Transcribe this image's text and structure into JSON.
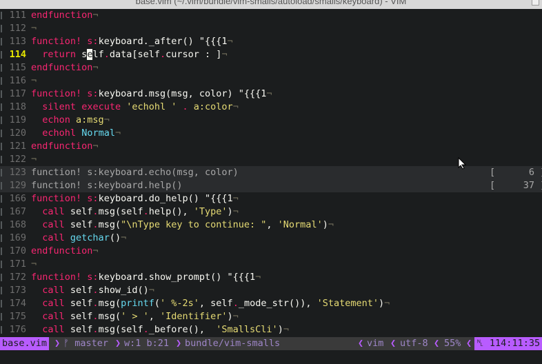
{
  "window": {
    "title": "base.vim (~/.vim/bundle/vim-smalls/autoload/smalls/keyboard) - VIM"
  },
  "lines": [
    {
      "num": "111",
      "tokens": [
        {
          "t": "endfunction",
          "c": "k"
        },
        {
          "t": "¬",
          "c": "m"
        }
      ]
    },
    {
      "num": "112",
      "tokens": [
        {
          "t": "¬",
          "c": "m"
        }
      ]
    },
    {
      "num": "113",
      "tokens": [
        {
          "t": "function!",
          "c": "k"
        },
        {
          "t": " ",
          "c": ""
        },
        {
          "t": "s:",
          "c": "k"
        },
        {
          "t": "keyboard._after() \"{{{1",
          "c": ""
        },
        {
          "t": "¬",
          "c": "m"
        }
      ]
    },
    {
      "num": "114",
      "current": true,
      "tokens": [
        {
          "t": "  ",
          "c": ""
        },
        {
          "t": "return",
          "c": "k"
        },
        {
          "t": " s",
          "c": ""
        },
        {
          "t": "e",
          "c": "cursor"
        },
        {
          "t": "lf",
          "c": ""
        },
        {
          "t": ".",
          "c": "k"
        },
        {
          "t": "data[self",
          "c": ""
        },
        {
          "t": ".",
          "c": "k"
        },
        {
          "t": "cursor : ]",
          "c": ""
        },
        {
          "t": "¬",
          "c": "m"
        }
      ]
    },
    {
      "num": "115",
      "tokens": [
        {
          "t": "endfunction",
          "c": "k"
        },
        {
          "t": "¬",
          "c": "m"
        }
      ]
    },
    {
      "num": "116",
      "tokens": [
        {
          "t": "¬",
          "c": "m"
        }
      ]
    },
    {
      "num": "117",
      "tokens": [
        {
          "t": "function!",
          "c": "k"
        },
        {
          "t": " ",
          "c": ""
        },
        {
          "t": "s:",
          "c": "k"
        },
        {
          "t": "keyboard.msg(msg, color) \"{{{1",
          "c": ""
        },
        {
          "t": "¬",
          "c": "m"
        }
      ]
    },
    {
      "num": "118",
      "tokens": [
        {
          "t": "  ",
          "c": ""
        },
        {
          "t": "silent",
          "c": "k"
        },
        {
          "t": " ",
          "c": ""
        },
        {
          "t": "execute",
          "c": "k"
        },
        {
          "t": " ",
          "c": ""
        },
        {
          "t": "'echohl '",
          "c": "s"
        },
        {
          "t": " . ",
          "c": "k"
        },
        {
          "t": "a:color",
          "c": "s"
        },
        {
          "t": "¬",
          "c": "m"
        }
      ]
    },
    {
      "num": "119",
      "tokens": [
        {
          "t": "  ",
          "c": ""
        },
        {
          "t": "echon",
          "c": "k"
        },
        {
          "t": " ",
          "c": ""
        },
        {
          "t": "a:msg",
          "c": "s"
        },
        {
          "t": "¬",
          "c": "m"
        }
      ]
    },
    {
      "num": "120",
      "tokens": [
        {
          "t": "  ",
          "c": ""
        },
        {
          "t": "echohl",
          "c": "k"
        },
        {
          "t": " ",
          "c": ""
        },
        {
          "t": "Normal",
          "c": "c"
        },
        {
          "t": "¬",
          "c": "m"
        }
      ]
    },
    {
      "num": "121",
      "tokens": [
        {
          "t": "endfunction",
          "c": "k"
        },
        {
          "t": "¬",
          "c": "m"
        }
      ]
    },
    {
      "num": "122",
      "tokens": [
        {
          "t": "¬",
          "c": "m"
        }
      ]
    },
    {
      "num": "123",
      "fold": true,
      "count": "[      6 ]",
      "tokens": [
        {
          "t": "function! s:keyboard.echo(msg, color)",
          "c": ""
        }
      ]
    },
    {
      "num": "129",
      "fold": true,
      "count": "[     37 ]",
      "tokens": [
        {
          "t": "function! s:keyboard.help()",
          "c": ""
        }
      ]
    },
    {
      "num": "166",
      "tokens": [
        {
          "t": "function!",
          "c": "k"
        },
        {
          "t": " ",
          "c": ""
        },
        {
          "t": "s:",
          "c": "k"
        },
        {
          "t": "keyboard.do_help() \"{{{1",
          "c": ""
        },
        {
          "t": "¬",
          "c": "m"
        }
      ]
    },
    {
      "num": "167",
      "tokens": [
        {
          "t": "  ",
          "c": ""
        },
        {
          "t": "call",
          "c": "k"
        },
        {
          "t": " self",
          "c": ""
        },
        {
          "t": ".",
          "c": "k"
        },
        {
          "t": "msg(self",
          "c": ""
        },
        {
          "t": ".",
          "c": "k"
        },
        {
          "t": "help(), ",
          "c": ""
        },
        {
          "t": "'Type'",
          "c": "s"
        },
        {
          "t": ")",
          "c": ""
        },
        {
          "t": "¬",
          "c": "m"
        }
      ]
    },
    {
      "num": "168",
      "tokens": [
        {
          "t": "  ",
          "c": ""
        },
        {
          "t": "call",
          "c": "k"
        },
        {
          "t": " self",
          "c": ""
        },
        {
          "t": ".",
          "c": "k"
        },
        {
          "t": "msg(",
          "c": ""
        },
        {
          "t": "\"\\nType key to continue: \"",
          "c": "s"
        },
        {
          "t": ", ",
          "c": ""
        },
        {
          "t": "'Normal'",
          "c": "s"
        },
        {
          "t": ")",
          "c": ""
        },
        {
          "t": "¬",
          "c": "m"
        }
      ]
    },
    {
      "num": "169",
      "tokens": [
        {
          "t": "  ",
          "c": ""
        },
        {
          "t": "call",
          "c": "k"
        },
        {
          "t": " ",
          "c": ""
        },
        {
          "t": "getchar",
          "c": "c"
        },
        {
          "t": "()",
          "c": ""
        },
        {
          "t": "¬",
          "c": "m"
        }
      ]
    },
    {
      "num": "170",
      "tokens": [
        {
          "t": "endfunction",
          "c": "k"
        },
        {
          "t": "¬",
          "c": "m"
        }
      ]
    },
    {
      "num": "171",
      "tokens": [
        {
          "t": "¬",
          "c": "m"
        }
      ]
    },
    {
      "num": "172",
      "tokens": [
        {
          "t": "function!",
          "c": "k"
        },
        {
          "t": " ",
          "c": ""
        },
        {
          "t": "s:",
          "c": "k"
        },
        {
          "t": "keyboard.show_prompt() \"{{{1",
          "c": ""
        },
        {
          "t": "¬",
          "c": "m"
        }
      ]
    },
    {
      "num": "173",
      "tokens": [
        {
          "t": "  ",
          "c": ""
        },
        {
          "t": "call",
          "c": "k"
        },
        {
          "t": " self",
          "c": ""
        },
        {
          "t": ".",
          "c": "k"
        },
        {
          "t": "show_id()",
          "c": ""
        },
        {
          "t": "¬",
          "c": "m"
        }
      ]
    },
    {
      "num": "174",
      "tokens": [
        {
          "t": "  ",
          "c": ""
        },
        {
          "t": "call",
          "c": "k"
        },
        {
          "t": " self",
          "c": ""
        },
        {
          "t": ".",
          "c": "k"
        },
        {
          "t": "msg(",
          "c": ""
        },
        {
          "t": "printf",
          "c": "c"
        },
        {
          "t": "(",
          "c": ""
        },
        {
          "t": "' %-2s'",
          "c": "s"
        },
        {
          "t": ", self",
          "c": ""
        },
        {
          "t": ".",
          "c": "k"
        },
        {
          "t": "_mode_str()), ",
          "c": ""
        },
        {
          "t": "'Statement'",
          "c": "s"
        },
        {
          "t": ")",
          "c": ""
        },
        {
          "t": "¬",
          "c": "m"
        }
      ]
    },
    {
      "num": "175",
      "tokens": [
        {
          "t": "  ",
          "c": ""
        },
        {
          "t": "call",
          "c": "k"
        },
        {
          "t": " self",
          "c": ""
        },
        {
          "t": ".",
          "c": "k"
        },
        {
          "t": "msg(",
          "c": ""
        },
        {
          "t": "' > '",
          "c": "s"
        },
        {
          "t": ", ",
          "c": ""
        },
        {
          "t": "'Identifier'",
          "c": "s"
        },
        {
          "t": ")",
          "c": ""
        },
        {
          "t": "¬",
          "c": "m"
        }
      ]
    },
    {
      "num": "176",
      "tokens": [
        {
          "t": "  ",
          "c": ""
        },
        {
          "t": "call",
          "c": "k"
        },
        {
          "t": " self",
          "c": ""
        },
        {
          "t": ".",
          "c": "k"
        },
        {
          "t": "msg(self",
          "c": ""
        },
        {
          "t": ".",
          "c": "k"
        },
        {
          "t": "_before(),  ",
          "c": ""
        },
        {
          "t": "'SmallsCli'",
          "c": "s"
        },
        {
          "t": ")",
          "c": ""
        },
        {
          "t": "¬",
          "c": "m"
        }
      ]
    }
  ],
  "statusline": {
    "mode": "base.vim",
    "branch": "ᚠ master",
    "wb": "w:1 b:21",
    "path": "bundle/vim-smalls",
    "filetype": "vim",
    "encoding": "utf-8",
    "percent": "55%",
    "position": "␤ 114:11:35"
  },
  "colors": {
    "keyword": "#f92672",
    "string": "#e6db74",
    "builtin": "#66d9ef",
    "accent": "#b85cff",
    "current_line_number": "#e6e600"
  }
}
